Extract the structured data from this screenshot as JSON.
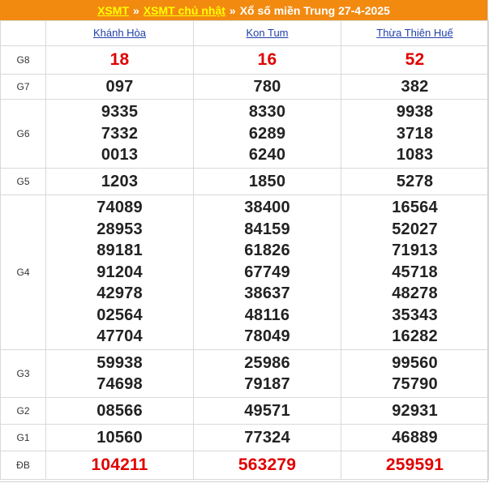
{
  "banner": {
    "link1": "XSMT",
    "sep1": "»",
    "link2": "XSMT chủ nhật",
    "sep2": "»",
    "title": "Xổ số miền Trung 27-4-2025"
  },
  "provinces": [
    "Khánh Hòa",
    "Kon Tum",
    "Thừa Thiên Huế"
  ],
  "prizes": [
    {
      "label": "G8",
      "style": "red",
      "values": [
        [
          "18"
        ],
        [
          "16"
        ],
        [
          "52"
        ]
      ]
    },
    {
      "label": "G7",
      "style": "normal",
      "values": [
        [
          "097"
        ],
        [
          "780"
        ],
        [
          "382"
        ]
      ]
    },
    {
      "label": "G6",
      "style": "normal",
      "values": [
        [
          "9335",
          "7332",
          "0013"
        ],
        [
          "8330",
          "6289",
          "6240"
        ],
        [
          "9938",
          "3718",
          "1083"
        ]
      ]
    },
    {
      "label": "G5",
      "style": "normal",
      "values": [
        [
          "1203"
        ],
        [
          "1850"
        ],
        [
          "5278"
        ]
      ]
    },
    {
      "label": "G4",
      "style": "normal",
      "values": [
        [
          "74089",
          "28953",
          "89181",
          "91204",
          "42978",
          "02564",
          "47704"
        ],
        [
          "38400",
          "84159",
          "61826",
          "67749",
          "38637",
          "48116",
          "78049"
        ],
        [
          "16564",
          "52027",
          "71913",
          "45718",
          "48278",
          "35343",
          "16282"
        ]
      ]
    },
    {
      "label": "G3",
      "style": "normal",
      "values": [
        [
          "59938",
          "74698"
        ],
        [
          "25986",
          "79187"
        ],
        [
          "99560",
          "75790"
        ]
      ]
    },
    {
      "label": "G2",
      "style": "normal",
      "values": [
        [
          "08566"
        ],
        [
          "49571"
        ],
        [
          "92931"
        ]
      ]
    },
    {
      "label": "G1",
      "style": "normal",
      "values": [
        [
          "10560"
        ],
        [
          "77324"
        ],
        [
          "46889"
        ]
      ]
    },
    {
      "label": "ĐB",
      "style": "big",
      "values": [
        [
          "104211"
        ],
        [
          "563279"
        ],
        [
          "259591"
        ]
      ]
    }
  ],
  "colors": {
    "banner_bg": "#f28a10",
    "banner_link": "#ffff00",
    "special": "#e00000",
    "province_link": "#1f3fa8"
  }
}
